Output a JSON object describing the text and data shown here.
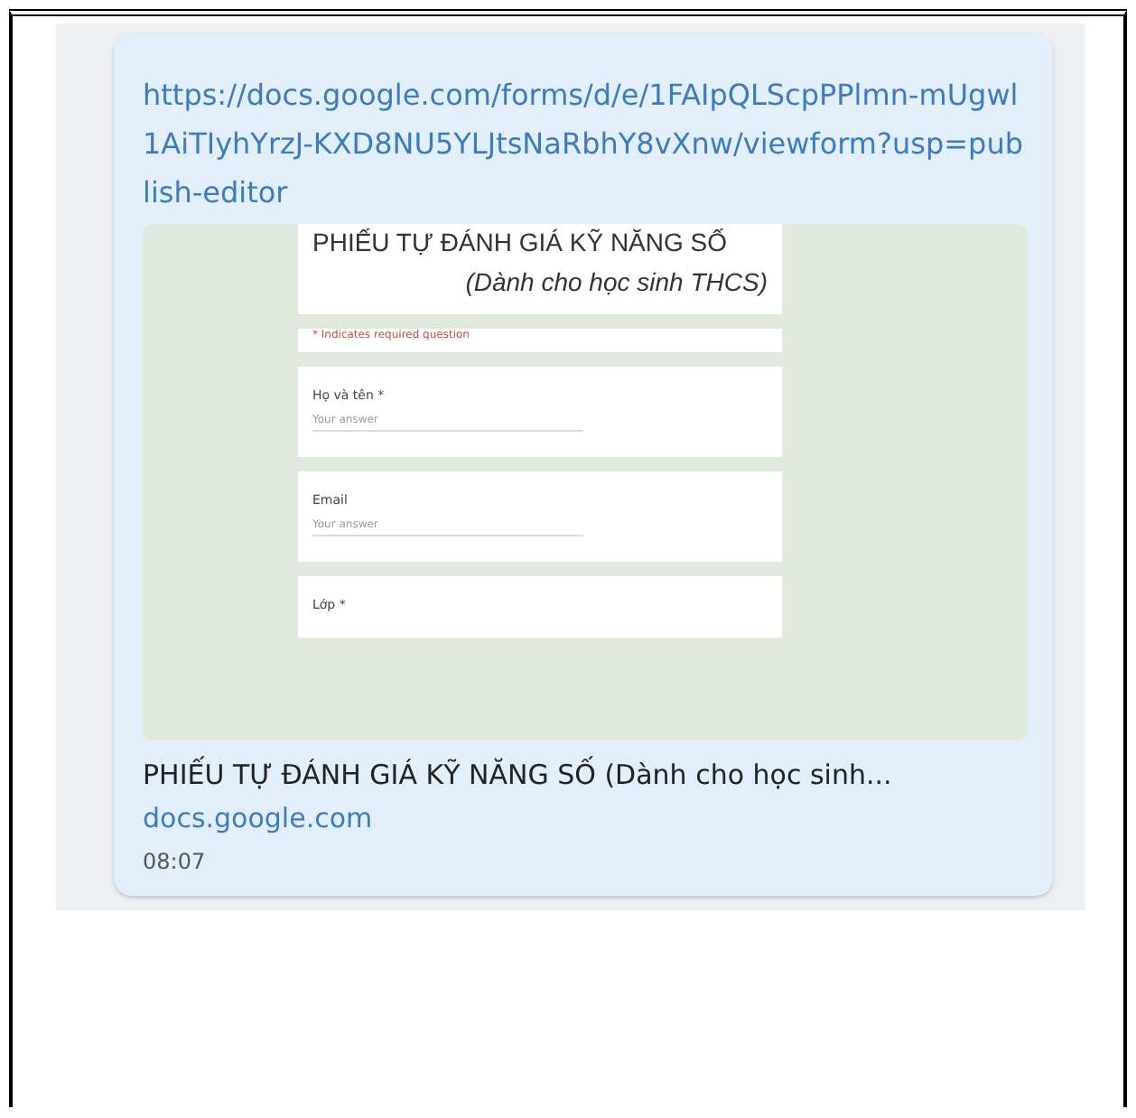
{
  "message": {
    "link": "https://docs.google.com/forms/d/e/1FAIpQLScpPPlmn-mUgwl1AiTIyhYrzJ-KXD8NU5YLJtsNaRbhY8vXnw/viewform?usp=publish-editor",
    "preview": {
      "form_title": "PHIẾU TỰ ĐÁNH GIÁ KỸ NĂNG SỐ",
      "form_subtitle": "(Dành cho học sinh THCS)",
      "required_note": "* Indicates required question",
      "questions": [
        {
          "label": "Họ và tên *",
          "placeholder": "Your answer"
        },
        {
          "label": "Email",
          "placeholder": "Your answer"
        },
        {
          "label": "Lớp *"
        }
      ]
    },
    "title": "PHIẾU TỰ ĐÁNH GIÁ KỸ NĂNG SỐ (Dành cho học sinh...",
    "domain": "docs.google.com",
    "time": "08:07"
  }
}
